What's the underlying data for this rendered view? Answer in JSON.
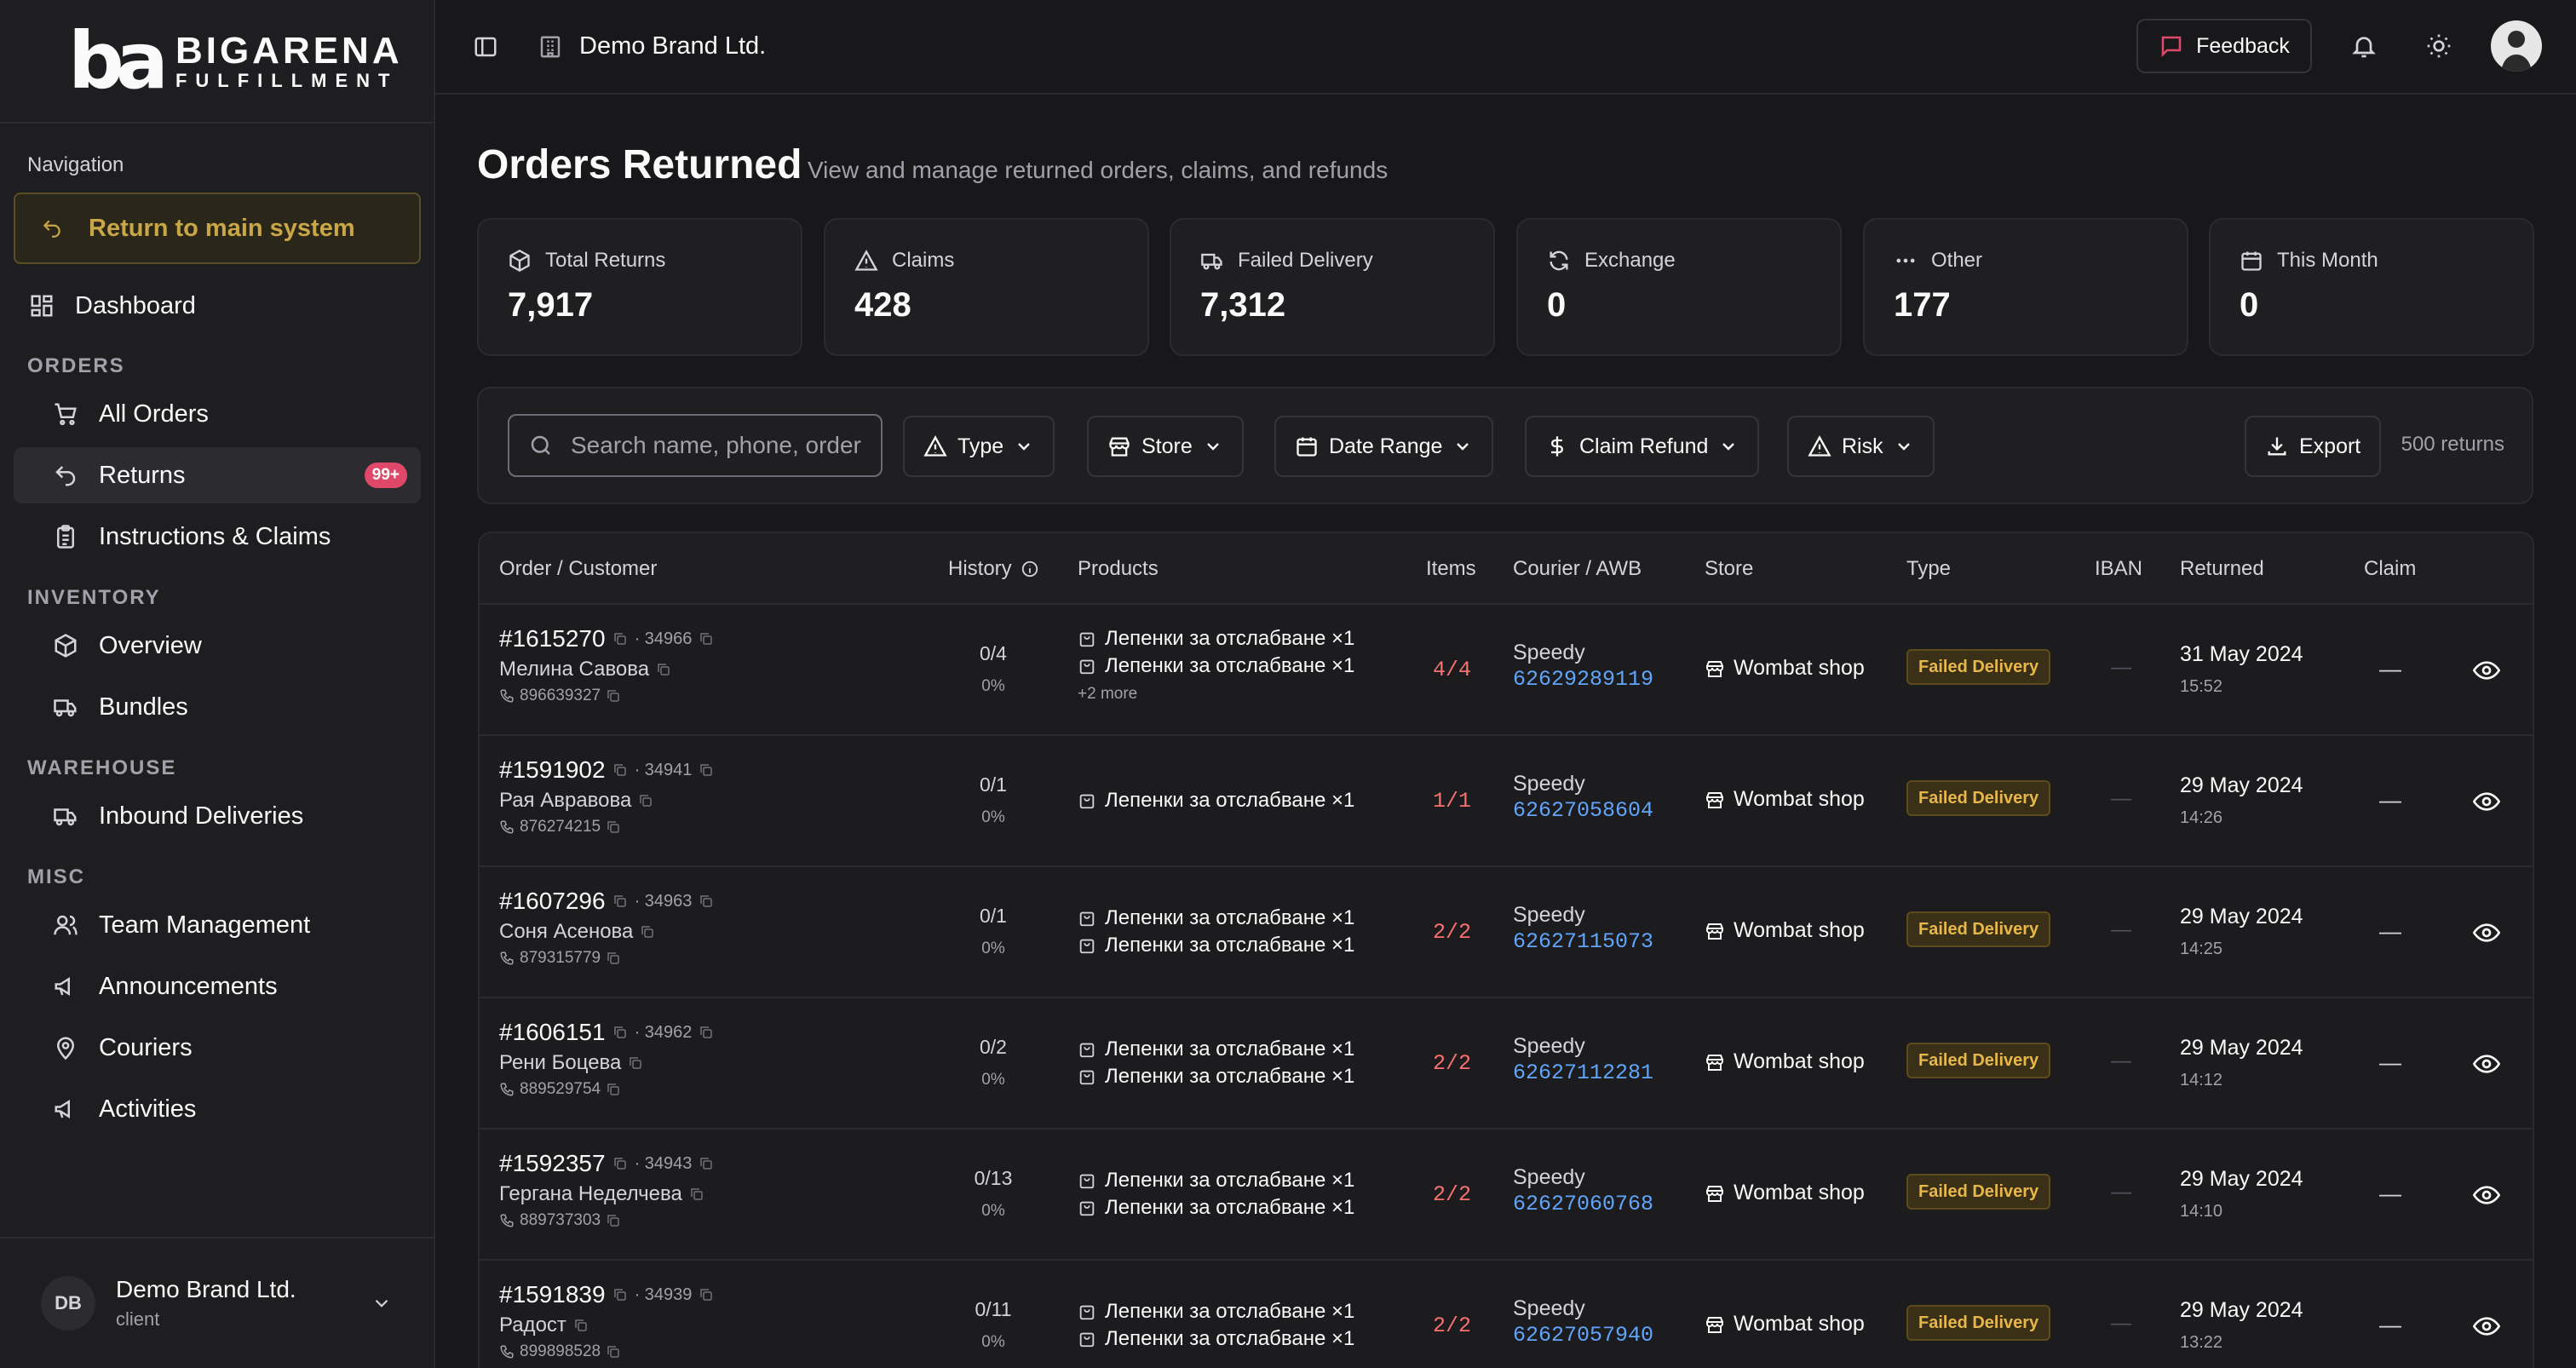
{
  "brand": {
    "mark": "ba",
    "word1": "BIGARENA",
    "word2": "FULFILLMENT"
  },
  "sidebar": {
    "nav_heading": "Navigation",
    "return_label": "Return to main system",
    "dashboard": "Dashboard",
    "groups": {
      "orders": "ORDERS",
      "inventory": "INVENTORY",
      "warehouse": "WAREHOUSE",
      "misc": "MISC"
    },
    "items": {
      "all_orders": "All Orders",
      "returns": "Returns",
      "returns_badge": "99+",
      "instructions": "Instructions & Claims",
      "overview": "Overview",
      "bundles": "Bundles",
      "inbound": "Inbound Deliveries",
      "team": "Team Management",
      "announcements": "Announcements",
      "couriers": "Couriers",
      "activities": "Activities"
    },
    "account": {
      "initials": "DB",
      "name": "Demo Brand Ltd.",
      "role": "client"
    }
  },
  "topbar": {
    "org_name": "Demo Brand Ltd.",
    "feedback": "Feedback"
  },
  "page": {
    "title": "Orders Returned",
    "subtitle": "View and manage returned orders, claims, and refunds"
  },
  "stats": [
    {
      "label": "Total Returns",
      "value": "7,917",
      "icon": "box-icon"
    },
    {
      "label": "Claims",
      "value": "428",
      "icon": "alert-triangle-icon"
    },
    {
      "label": "Failed Delivery",
      "value": "7,312",
      "icon": "truck-icon"
    },
    {
      "label": "Exchange",
      "value": "0",
      "icon": "refresh-icon"
    },
    {
      "label": "Other",
      "value": "177",
      "icon": "ellipsis-icon"
    },
    {
      "label": "This Month",
      "value": "0",
      "icon": "calendar-icon"
    }
  ],
  "filters": {
    "search_placeholder": "Search name, phone, order",
    "type": "Type",
    "store": "Store",
    "date_range": "Date Range",
    "claim_refund": "Claim Refund",
    "risk": "Risk",
    "export": "Export",
    "count": "500 returns"
  },
  "table": {
    "headers": {
      "order": "Order / Customer",
      "history": "History",
      "products": "Products",
      "items": "Items",
      "courier": "Courier / AWB",
      "store": "Store",
      "type": "Type",
      "iban": "IBAN",
      "returned": "Returned",
      "claim": "Claim"
    },
    "rows": [
      {
        "order": "#1615270",
        "ref": "· 34966",
        "customer": "Мелина Савова",
        "phone": "896639327",
        "hist1": "0/4",
        "hist2": "0%",
        "products": [
          "Лепенки за отслабване ×1",
          "Лепенки за отслабване ×1"
        ],
        "more": "+2 more",
        "items": "4/4",
        "courier": "Speedy",
        "awb": "62629289119",
        "store": "Wombat shop",
        "type": "Failed Delivery",
        "iban": "—",
        "date": "31 May 2024",
        "time": "15:52",
        "claim": "—"
      },
      {
        "order": "#1591902",
        "ref": "· 34941",
        "customer": "Рая Авравова",
        "phone": "876274215",
        "hist1": "0/1",
        "hist2": "0%",
        "products": [
          "Лепенки за отслабване ×1"
        ],
        "more": "",
        "items": "1/1",
        "courier": "Speedy",
        "awb": "62627058604",
        "store": "Wombat shop",
        "type": "Failed Delivery",
        "iban": "—",
        "date": "29 May 2024",
        "time": "14:26",
        "claim": "—"
      },
      {
        "order": "#1607296",
        "ref": "· 34963",
        "customer": "Соня Асенова",
        "phone": "879315779",
        "hist1": "0/1",
        "hist2": "0%",
        "products": [
          "Лепенки за отслабване ×1",
          "Лепенки за отслабване ×1"
        ],
        "more": "",
        "items": "2/2",
        "courier": "Speedy",
        "awb": "62627115073",
        "store": "Wombat shop",
        "type": "Failed Delivery",
        "iban": "—",
        "date": "29 May 2024",
        "time": "14:25",
        "claim": "—"
      },
      {
        "order": "#1606151",
        "ref": "· 34962",
        "customer": "Рени Боцева",
        "phone": "889529754",
        "hist1": "0/2",
        "hist2": "0%",
        "products": [
          "Лепенки за отслабване ×1",
          "Лепенки за отслабване ×1"
        ],
        "more": "",
        "items": "2/2",
        "courier": "Speedy",
        "awb": "62627112281",
        "store": "Wombat shop",
        "type": "Failed Delivery",
        "iban": "—",
        "date": "29 May 2024",
        "time": "14:12",
        "claim": "—"
      },
      {
        "order": "#1592357",
        "ref": "· 34943",
        "customer": "Гергана Неделчева",
        "phone": "889737303",
        "hist1": "0/13",
        "hist2": "0%",
        "products": [
          "Лепенки за отслабване ×1",
          "Лепенки за отслабване ×1"
        ],
        "more": "",
        "items": "2/2",
        "courier": "Speedy",
        "awb": "62627060768",
        "store": "Wombat shop",
        "type": "Failed Delivery",
        "iban": "—",
        "date": "29 May 2024",
        "time": "14:10",
        "claim": "—"
      },
      {
        "order": "#1591839",
        "ref": "· 34939",
        "customer": "Радост",
        "phone": "899898528",
        "hist1": "0/11",
        "hist2": "0%",
        "products": [
          "Лепенки за отслабване ×1",
          "Лепенки за отслабване ×1"
        ],
        "more": "",
        "items": "2/2",
        "courier": "Speedy",
        "awb": "62627057940",
        "store": "Wombat shop",
        "type": "Failed Delivery",
        "iban": "—",
        "date": "29 May 2024",
        "time": "13:22",
        "claim": "—"
      }
    ]
  },
  "colors": {
    "accent_gold": "#c9a646",
    "badge_red": "#e0486a",
    "awb_blue": "#60a5fa",
    "items_red": "#f87171",
    "failed_badge": "#e7b74a"
  }
}
